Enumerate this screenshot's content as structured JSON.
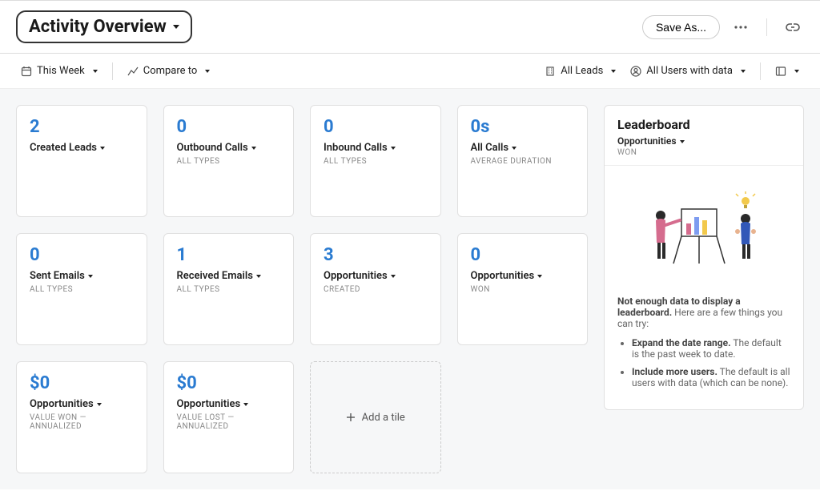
{
  "header": {
    "title": "Activity Overview",
    "save_as": "Save As..."
  },
  "filters": {
    "this_week": "This Week",
    "compare_to": "Compare to",
    "all_leads": "All Leads",
    "all_users": "All Users with data"
  },
  "tiles": [
    {
      "value": "2",
      "title": "Created Leads",
      "sub": ""
    },
    {
      "value": "0",
      "title": "Outbound Calls",
      "sub": "ALL TYPES"
    },
    {
      "value": "0",
      "title": "Inbound Calls",
      "sub": "ALL TYPES"
    },
    {
      "value": "0s",
      "title": "All Calls",
      "sub": "AVERAGE DURATION"
    },
    {
      "value": "0",
      "title": "Sent Emails",
      "sub": "ALL TYPES"
    },
    {
      "value": "1",
      "title": "Received Emails",
      "sub": "ALL TYPES"
    },
    {
      "value": "3",
      "title": "Opportunities",
      "sub": "CREATED"
    },
    {
      "value": "0",
      "title": "Opportunities",
      "sub": "WON"
    },
    {
      "value": "$0",
      "title": "Opportunities",
      "sub": "VALUE WON — ANNUALIZED"
    },
    {
      "value": "$0",
      "title": "Opportunities",
      "sub": "VALUE LOST — ANNUALIZED"
    }
  ],
  "add_tile": "Add a tile",
  "leaderboard": {
    "title": "Leaderboard",
    "metric": "Opportunities",
    "metric_sub": "WON",
    "msg_bold": "Not enough data to display a leaderboard.",
    "msg_rest": " Here are a few things you can try:",
    "tip1_bold": "Expand the date range.",
    "tip1_rest": " The default is the past week to date.",
    "tip2_bold": "Include more users.",
    "tip2_rest": " The default is all users with data (which can be none)."
  }
}
